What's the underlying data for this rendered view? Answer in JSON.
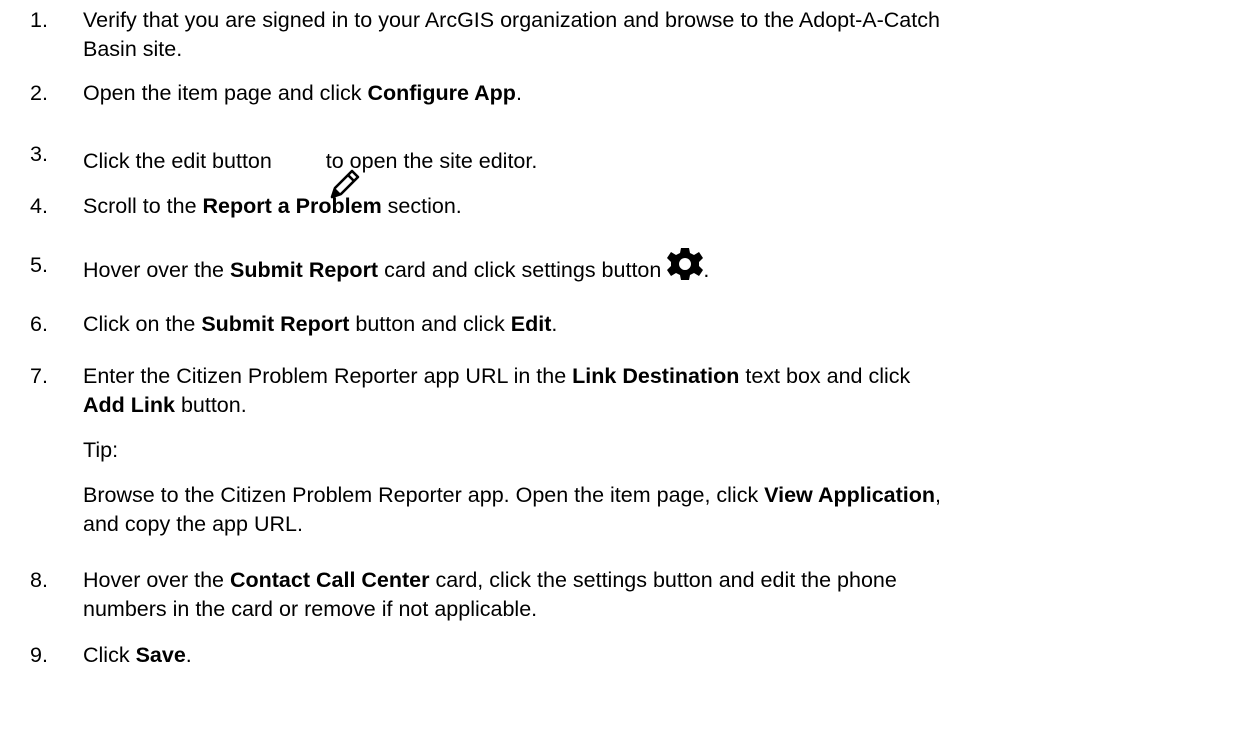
{
  "steps": [
    {
      "number": "1.",
      "lines": [
        "Verify that you are signed in to your ArcGIS organization and browse to the Adopt-A-Catch",
        "Basin site."
      ]
    },
    {
      "number": "2.",
      "pre": "Open the item page and click ",
      "bold": "Configure App",
      "post": "."
    },
    {
      "number": "3.",
      "pre": "Click the edit button ",
      "icon": "pencil-icon",
      "post": "  to open the site editor."
    },
    {
      "number": "4.",
      "pre": "Scroll to the ",
      "bold": "Report a Problem",
      "post": " section."
    },
    {
      "number": "5.",
      "pre": "Hover over the ",
      "bold": "Submit Report",
      "mid": " card and click settings button ",
      "icon": "gear-icon",
      "post": "."
    },
    {
      "number": "6.",
      "pre": "Click on the ",
      "bold": "Submit Report",
      "mid": " button and click ",
      "bold2": "Edit",
      "post": "."
    },
    {
      "number": "7.",
      "pre": "Enter the Citizen Problem Reporter app URL in the ",
      "bold": "Link Destination",
      "mid": " text box and click",
      "bold2": "Add Link",
      "post": " button."
    },
    {
      "number": "8.",
      "pre": "Hover over the ",
      "bold": "Contact Call Center",
      "mid": " card, click the settings button and edit the phone",
      "line2": "numbers in the card or remove if not applicable."
    },
    {
      "number": "9.",
      "pre": "Click ",
      "bold": "Save",
      "post": "."
    }
  ],
  "tip": {
    "label": "Tip:",
    "pre": "Browse to the Citizen Problem Reporter app. Open the item page, click ",
    "bold": "View Application",
    "post": ",",
    "line2": "and copy the app URL."
  }
}
